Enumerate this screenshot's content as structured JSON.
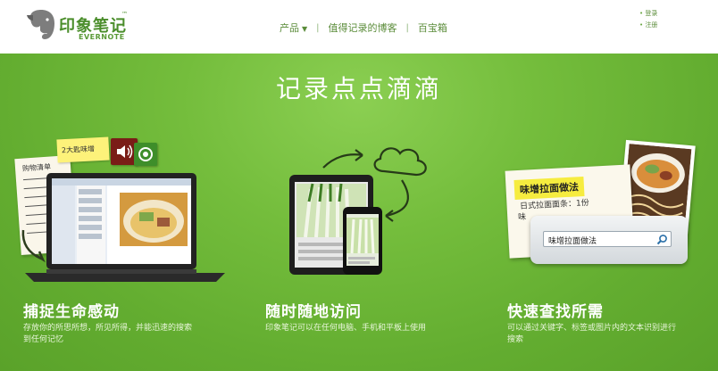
{
  "brand": {
    "name_cn": "印象笔记",
    "trademark": "™",
    "name_en": "EVERNOTE",
    "primary_color": "#4a8d2a",
    "hero_color": "#6db536"
  },
  "nav": {
    "items": [
      {
        "label": "产品",
        "has_dropdown": true
      },
      {
        "label": "值得记录的博客"
      },
      {
        "label": "百宝箱"
      }
    ],
    "separator": "|"
  },
  "auth": {
    "login": "登录",
    "register": "注册"
  },
  "hero": {
    "title": "记录点点滴滴"
  },
  "features": [
    {
      "title": "捕捉生命感动",
      "desc_line1": "存放你的所思所想，所见所得，并能迅速的搜索",
      "desc_line2": "到任何记忆",
      "illustration": {
        "notes_title": "购物清单",
        "sticky_text": "2大匙味增",
        "icons": [
          "speaker-icon",
          "camera-icon"
        ]
      }
    },
    {
      "title": "随时随地访问",
      "desc_line1": "印象笔记可以在任何电脑、手机和平板上使用",
      "illustration": {
        "icons": [
          "cloud-icon",
          "sync-arrow-icon"
        ]
      }
    },
    {
      "title": "快速查找所需",
      "desc_line1": "可以通过关键字、标签或图片内的文本识别进行",
      "desc_line2": "搜索",
      "illustration": {
        "banner": "味增拉面做法",
        "line1": "日式拉面面条：1份",
        "line2": "味",
        "search_value": "味增拉面做法"
      }
    }
  ]
}
